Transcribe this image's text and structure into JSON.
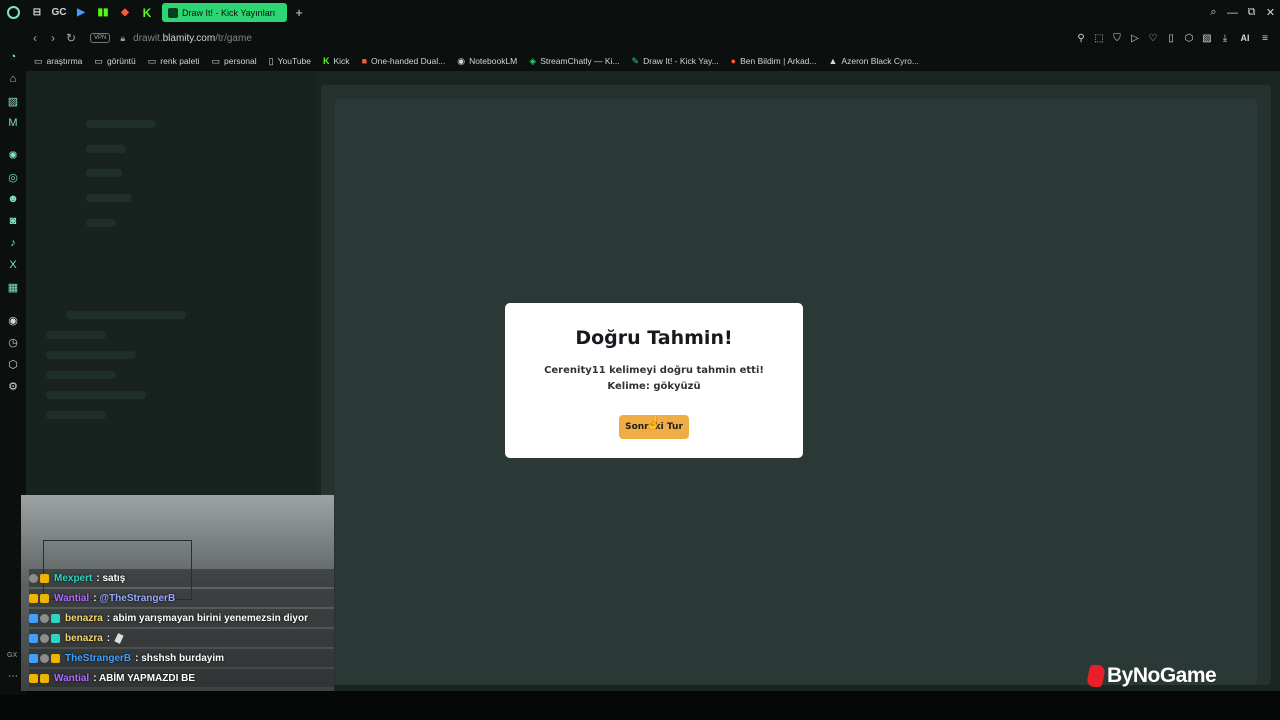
{
  "tabs": {
    "pinned": [
      {
        "name": "gx-logo-icon"
      },
      {
        "name": "gamepad-icon",
        "glyph": "⊟"
      },
      {
        "name": "gc-icon",
        "glyph": "GC"
      },
      {
        "name": "play-icon",
        "glyph": "▶"
      },
      {
        "name": "bars-icon",
        "glyph": "▮▮"
      },
      {
        "name": "red-logo-icon",
        "glyph": "◆"
      },
      {
        "name": "kick-icon",
        "glyph": "K"
      }
    ],
    "active_title": "Draw It! - Kick Yayınları",
    "add_glyph": "+"
  },
  "window_controls": [
    "⌕",
    "—",
    "⧉",
    "✕"
  ],
  "addressbar": {
    "vpn": "VPN",
    "url_prefix": "drawit.",
    "url_domain": "blamity.com",
    "url_path": "/tr/game",
    "ai_label": "AI"
  },
  "bookmarks": [
    {
      "label": "araştırma",
      "icon": "folder-icon"
    },
    {
      "label": "görüntü",
      "icon": "folder-icon"
    },
    {
      "label": "renk paleti",
      "icon": "folder-icon"
    },
    {
      "label": "personal",
      "icon": "folder-icon"
    },
    {
      "label": "YouTube",
      "icon": "page-icon"
    },
    {
      "label": "Kick",
      "icon": "kick-icon"
    },
    {
      "label": "One-handed Dual...",
      "icon": "red-square-icon"
    },
    {
      "label": "NotebookLM",
      "icon": "notebook-icon"
    },
    {
      "label": "StreamChatly — Ki...",
      "icon": "chat-icon"
    },
    {
      "label": "Draw It! - Kick Yay...",
      "icon": "pencil-icon"
    },
    {
      "label": "Ben Bildim | Arkad...",
      "icon": "bulb-icon"
    },
    {
      "label": "Azeron Black Cyro...",
      "icon": "controller-icon"
    }
  ],
  "dialog": {
    "title": "Doğru Tahmin!",
    "message": "Cerenity11 kelimeyi doğru tahmin etti! Kelime: gökyüzü",
    "button": "Sonraki Tur"
  },
  "chat": [
    {
      "user": "Mexpert",
      "user_color": "#2ed5c0",
      "text": "satış",
      "badges": [
        "b-gray",
        "b-gold"
      ]
    },
    {
      "user": "Wantial",
      "user_color": "#b06bff",
      "text": "@TheStrangerB",
      "text_color": "#9aa8ff",
      "badges": [
        "b-gold",
        "b-gold"
      ]
    },
    {
      "user": "benazra",
      "user_color": "#f5d76e",
      "text": "abim yarışmayan birini yenemezsin diyor",
      "badges": [
        "b-blue",
        "b-gray",
        "b-teal"
      ]
    },
    {
      "user": "benazra",
      "user_color": "#f5d76e",
      "text": "",
      "badges": [
        "b-blue",
        "b-gray",
        "b-teal"
      ]
    },
    {
      "user": "TheStrangerB",
      "user_color": "#3fa1ff",
      "text": "shshsh burdayim",
      "badges": [
        "b-blue",
        "b-gray",
        "b-gold"
      ]
    },
    {
      "user": "Wantial",
      "user_color": "#b06bff",
      "text": "ABİM YAPMAZDI BE",
      "badges": [
        "b-gold",
        "b-gold"
      ]
    }
  ],
  "watermark": "ByNoGame",
  "colors": {
    "accent": "#2ed573",
    "button": "#f0ad45",
    "dialog_bg": "#ffffff"
  }
}
